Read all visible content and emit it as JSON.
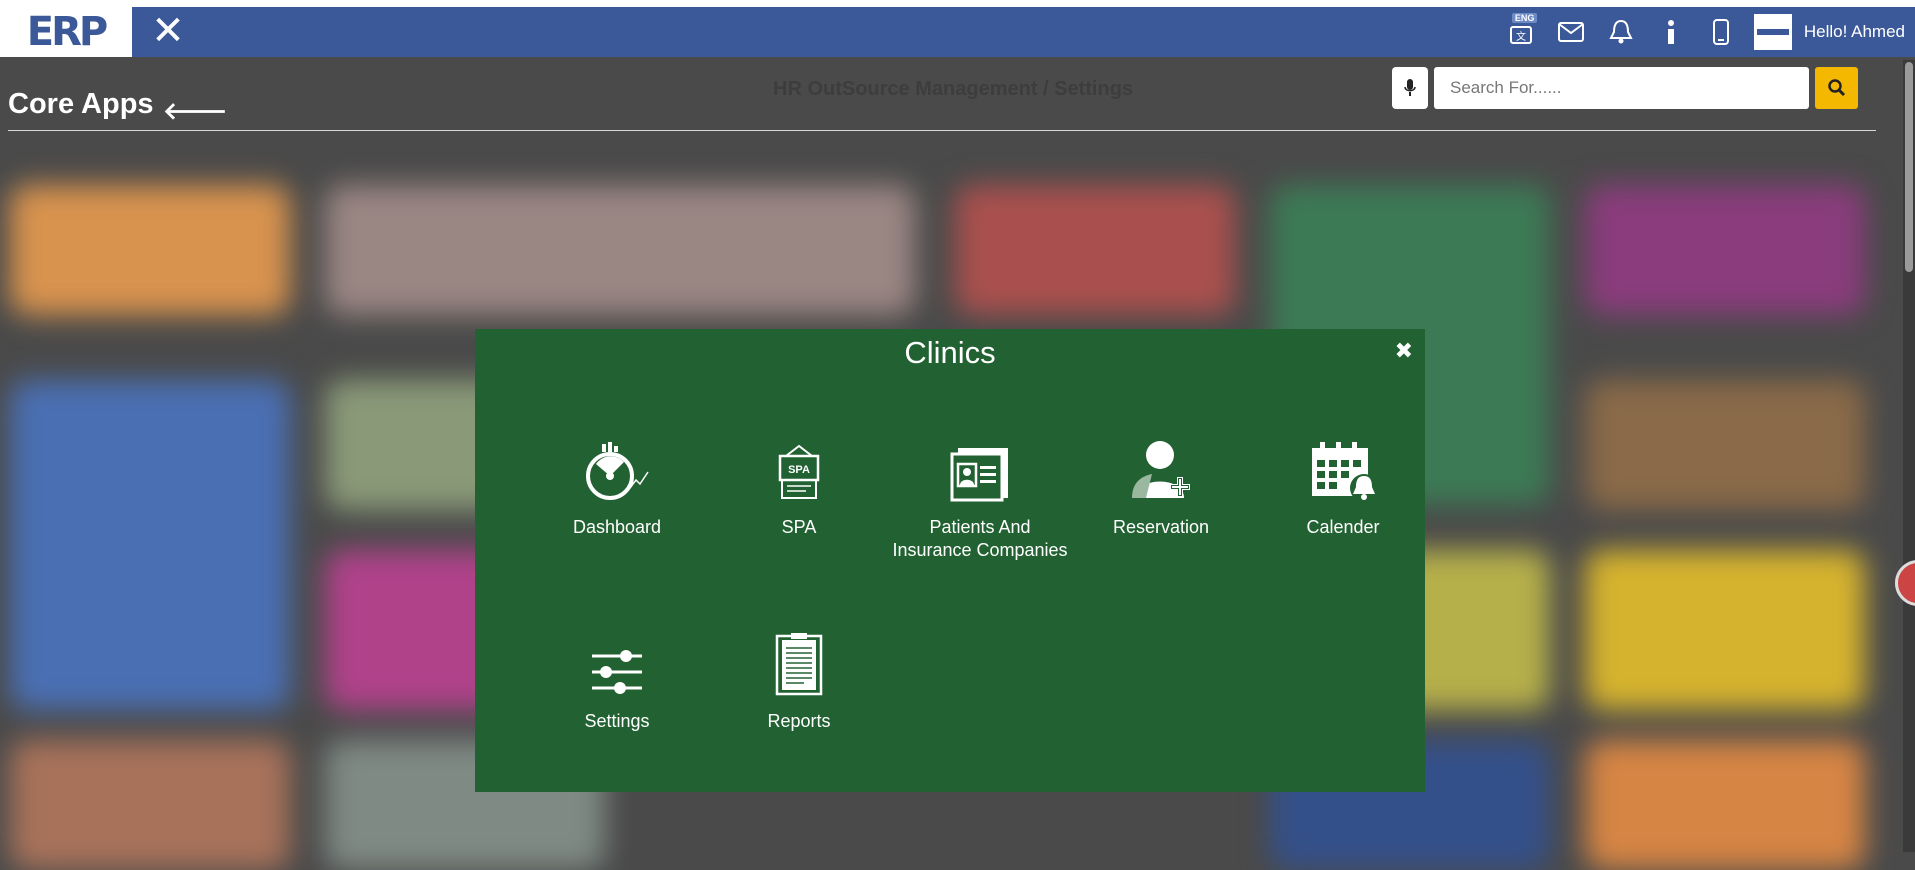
{
  "header": {
    "logo_text": "ERP",
    "lang_badge": "ENG",
    "greeting": "Hello! Ahmed"
  },
  "page": {
    "title": "Core Apps",
    "ghost_title": "HR OutSource Management / Settings"
  },
  "search": {
    "placeholder": "Search For......"
  },
  "modal": {
    "title": "Clinics",
    "apps": [
      {
        "label": "Dashboard",
        "icon": "dashboard-gauge-icon"
      },
      {
        "label": "SPA",
        "icon": "spa-sign-icon"
      },
      {
        "label": "Patients And Insurance Companies",
        "icon": "patient-card-icon"
      },
      {
        "label": "Reservation",
        "icon": "user-add-icon"
      },
      {
        "label": "Calender",
        "icon": "calendar-bell-icon"
      },
      {
        "label": "Settings",
        "icon": "sliders-icon"
      },
      {
        "label": "Reports",
        "icon": "clipboard-report-icon"
      }
    ]
  },
  "colors": {
    "topbar": "#3b5998",
    "modal": "#226232",
    "search_button": "#f5b800"
  }
}
